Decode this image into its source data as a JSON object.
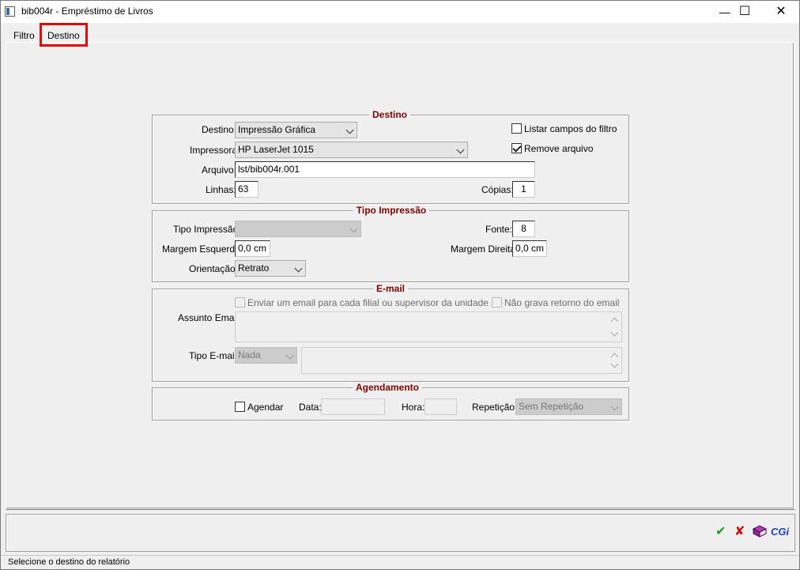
{
  "window": {
    "title": "bib004r - Empréstimo de Livros",
    "minimize_glyph": "—",
    "maximize_glyph": "☐",
    "close_glyph": "✕"
  },
  "tabs": [
    {
      "label": "Filtro",
      "active": false
    },
    {
      "label": "Destino",
      "active": true,
      "highlighted": true
    }
  ],
  "destino": {
    "group_title": "Destino",
    "destino_label": "Destino:",
    "destino_value": "Impressão Gráfica",
    "impressora_label": "Impressora:",
    "impressora_value": "HP LaserJet 1015",
    "arquivo_label": "Arquivo:",
    "arquivo_value": "lst/bib004r.001",
    "linhas_label": "Linhas:",
    "linhas_value": "63",
    "copias_label": "Cópias:",
    "copias_value": "1",
    "listar_campos_label": "Listar campos do filtro",
    "listar_campos_checked": false,
    "remove_arquivo_label": "Remove arquivo",
    "remove_arquivo_checked": true
  },
  "tipo_impressao": {
    "group_title": "Tipo Impressão",
    "tipo_label": "Tipo Impressão:",
    "tipo_value": "",
    "fonte_label": "Fonte:",
    "fonte_value": "8",
    "margem_esquerda_label": "Margem Esquerda:",
    "margem_esquerda_value": "0,0 cm",
    "margem_direita_label": "Margem Direita:",
    "margem_direita_value": "0,0 cm",
    "orientacao_label": "Orientação:",
    "orientacao_value": "Retrato"
  },
  "email": {
    "group_title": "E-mail",
    "enviar_label": "Enviar um email para cada filial ou supervisor da unidade",
    "enviar_checked": false,
    "nao_grava_label": "Não grava retorno do email",
    "nao_grava_checked": false,
    "assunto_label": "Assunto Email:",
    "assunto_value": "",
    "tipo_label": "Tipo E-mail:",
    "tipo_value": "Nada",
    "corpo_value": ""
  },
  "agendamento": {
    "group_title": "Agendamento",
    "agendar_label": "Agendar",
    "agendar_checked": false,
    "data_label": "Data:",
    "data_value": "",
    "hora_label": "Hora:",
    "hora_value": "",
    "repeticao_label": "Repetição:",
    "repeticao_value": "Sem Repetição"
  },
  "toolbar": {
    "confirm_glyph": "✔",
    "cancel_glyph": "✘",
    "cgi_label": "CGi",
    "confirm_color": "#1e9e1e",
    "cancel_color": "#d01010",
    "cgi_color": "#1a3fb5"
  },
  "status": {
    "text": "Selecione o destino do relatório"
  }
}
